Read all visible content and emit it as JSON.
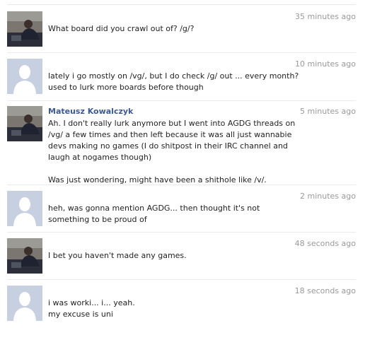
{
  "messages": [
    {
      "avatar": "user-photo-avatar",
      "sender": "",
      "time": "35 minutes ago",
      "paragraphs": [
        "What board did you crawl out of? /g/?"
      ]
    },
    {
      "avatar": "default-silhouette-avatar",
      "sender": "",
      "time": "10 minutes ago",
      "paragraphs": [
        "lately i go mostly on /vg/, but I do check /g/ out ... every month? used to lurk more boards before though"
      ]
    },
    {
      "avatar": "user-photo-avatar",
      "sender": "Mateusz Kowalczyk",
      "time": "5 minutes ago",
      "paragraphs": [
        "Ah. I don't really lurk anymore but I went into AGDG threads on /vg/ a few times and then left because it was all just wannabie devs making no games (I do shitpost in their IRC channel and laugh at nogames though)",
        "Was just wondering, might have been a shithole like /v/."
      ]
    },
    {
      "avatar": "default-silhouette-avatar",
      "sender": "",
      "time": "2 minutes ago",
      "paragraphs": [
        "heh, was gonna mention AGDG... then thought it's not something to be proud of"
      ]
    },
    {
      "avatar": "user-photo-avatar",
      "sender": "",
      "time": "48 seconds ago",
      "paragraphs": [
        "I bet you haven't made any games."
      ]
    },
    {
      "avatar": "default-silhouette-avatar",
      "sender": "",
      "time": "18 seconds ago",
      "paragraphs": [
        "i was worki... i... yeah.",
        "my excuse is uni"
      ]
    }
  ],
  "colors": {
    "sender_link": "#3b5998",
    "timestamp": "#999999",
    "separator": "#e9ebef"
  }
}
